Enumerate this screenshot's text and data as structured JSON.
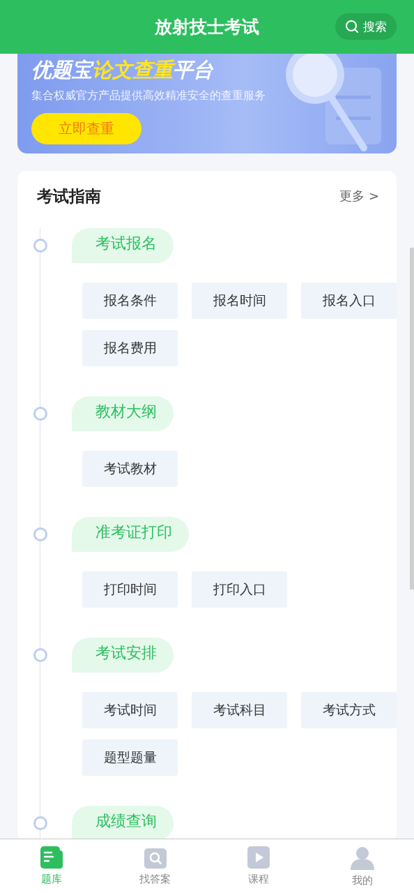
{
  "header": {
    "title": "放射技士考试",
    "search": "搜索"
  },
  "banner": {
    "title": [
      {
        "text": "优题宝",
        "highlight": false
      },
      {
        "text": "论文查重",
        "highlight": true
      },
      {
        "text": "平台",
        "highlight": false
      }
    ],
    "subtitle": "集合权威官方产品提供高效精准安全的查重服务",
    "button": "立即查重"
  },
  "guide": {
    "title": "考试指南",
    "more": "更多 >",
    "sections": [
      {
        "title": "考试报名",
        "items": [
          "报名条件",
          "报名时间",
          "报名入口",
          "报名费用"
        ]
      },
      {
        "title": "教材大纲",
        "items": [
          "考试教材"
        ]
      },
      {
        "title": "准考证打印",
        "items": [
          "打印时间",
          "打印入口"
        ]
      },
      {
        "title": "考试安排",
        "items": [
          "考试时间",
          "考试科目",
          "考试方式",
          "题型题量"
        ]
      },
      {
        "title": "成绩查询"
      }
    ]
  },
  "tabs": [
    {
      "label": "题库",
      "kind": "document",
      "selected": true
    },
    {
      "label": "找答案",
      "kind": "search",
      "selected": false
    },
    {
      "label": "课程",
      "kind": "play",
      "selected": false
    },
    {
      "label": "我的",
      "kind": "person",
      "selected": false
    }
  ]
}
